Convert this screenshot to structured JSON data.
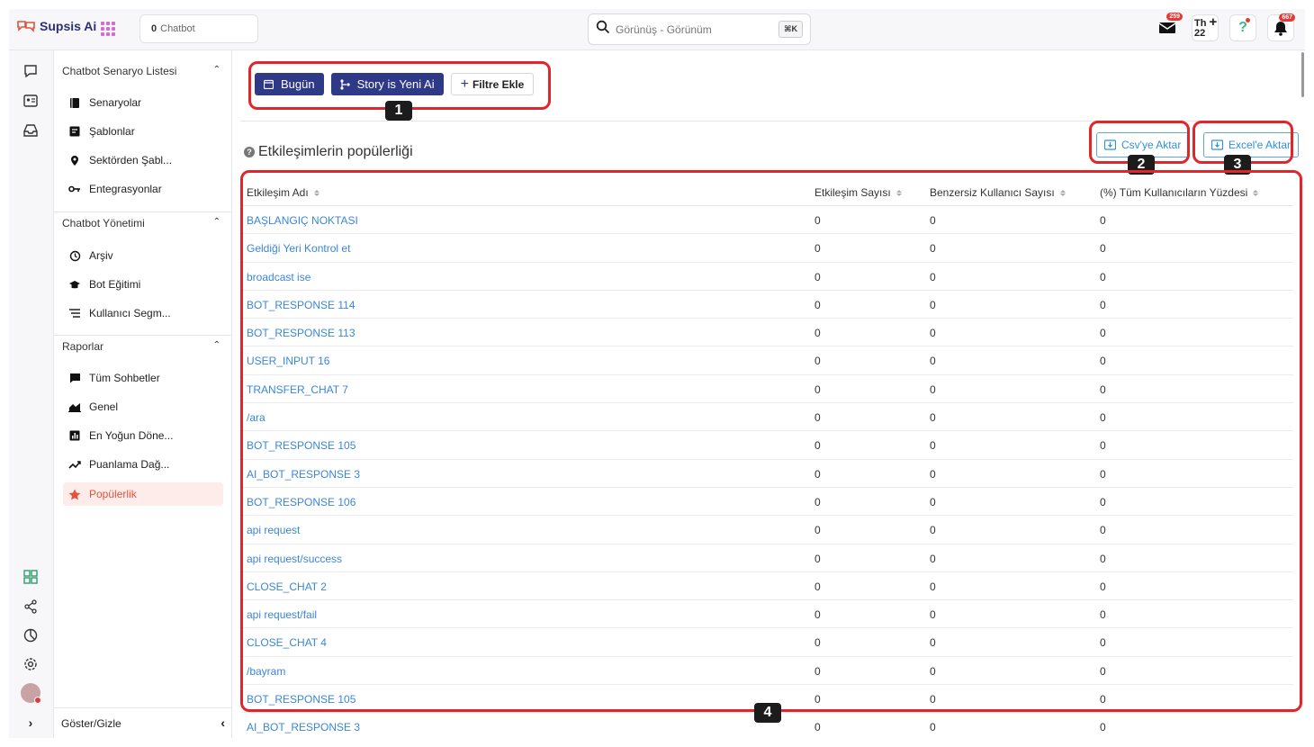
{
  "brand": {
    "name": "Supsis Ai"
  },
  "chatbot_selector": {
    "count": "0",
    "label": "Chatbot"
  },
  "search": {
    "placeholder": "Görünüş - Görünüm",
    "shortcut": "⌘K"
  },
  "topbar": {
    "mail_badge": "259",
    "th_label": "Th",
    "th_num": "22",
    "help": "?",
    "notif_badge": "667"
  },
  "sidebar": {
    "sections": [
      {
        "title": "Chatbot Senaryo Listesi",
        "items": [
          {
            "label": "Senaryolar",
            "icon": "book-icon"
          },
          {
            "label": "Şablonlar",
            "icon": "template-icon"
          },
          {
            "label": "Sektörden Şabl...",
            "icon": "location-icon"
          },
          {
            "label": "Entegrasyonlar",
            "icon": "key-icon"
          }
        ]
      },
      {
        "title": "Chatbot Yönetimi",
        "items": [
          {
            "label": "Arşiv",
            "icon": "history-icon"
          },
          {
            "label": "Bot Eğitimi",
            "icon": "graduation-cap-icon"
          },
          {
            "label": "Kullanıcı Segm...",
            "icon": "list-icon"
          }
        ]
      },
      {
        "title": "Raporlar",
        "items": [
          {
            "label": "Tüm Sohbetler",
            "icon": "chat-icon"
          },
          {
            "label": "Genel",
            "icon": "area-chart-icon"
          },
          {
            "label": "En Yoğun Döne...",
            "icon": "bar-chart-icon"
          },
          {
            "label": "Puanlama Dağ...",
            "icon": "trend-icon"
          },
          {
            "label": "Popülerlik",
            "icon": "star-icon"
          }
        ]
      }
    ],
    "toggle_label": "Göster/Gizle"
  },
  "filters": {
    "today": "Bugün",
    "story": "Story is Yeni Ai",
    "add_filter": "Filtre Ekle"
  },
  "page_title": "Etkileşimlerin popülerliği",
  "export": {
    "csv": "Csv'ye Aktar",
    "excel": "Excel'e Aktar"
  },
  "table": {
    "headers": [
      "Etkileşim Adı",
      "Etkileşim Sayısı",
      "Benzersiz Kullanıcı Sayısı",
      "(%) Tüm Kullanıcıların Yüzdesi"
    ],
    "rows": [
      [
        "BAŞLANGIÇ NOKTASI",
        "0",
        "0",
        "0"
      ],
      [
        "Geldiği Yeri Kontrol et",
        "0",
        "0",
        "0"
      ],
      [
        "broadcast ise",
        "0",
        "0",
        "0"
      ],
      [
        "BOT_RESPONSE 114",
        "0",
        "0",
        "0"
      ],
      [
        "BOT_RESPONSE 113",
        "0",
        "0",
        "0"
      ],
      [
        "USER_INPUT 16",
        "0",
        "0",
        "0"
      ],
      [
        "TRANSFER_CHAT 7",
        "0",
        "0",
        "0"
      ],
      [
        "/ara",
        "0",
        "0",
        "0"
      ],
      [
        "BOT_RESPONSE 105",
        "0",
        "0",
        "0"
      ],
      [
        "AI_BOT_RESPONSE 3",
        "0",
        "0",
        "0"
      ],
      [
        "BOT_RESPONSE 106",
        "0",
        "0",
        "0"
      ],
      [
        "api request",
        "0",
        "0",
        "0"
      ],
      [
        "api request/success",
        "0",
        "0",
        "0"
      ],
      [
        "CLOSE_CHAT 2",
        "0",
        "0",
        "0"
      ],
      [
        "api request/fail",
        "0",
        "0",
        "0"
      ],
      [
        "CLOSE_CHAT 4",
        "0",
        "0",
        "0"
      ],
      [
        "/bayram",
        "0",
        "0",
        "0"
      ],
      [
        "BOT_RESPONSE 105",
        "0",
        "0",
        "0"
      ],
      [
        "AI_BOT_RESPONSE 3",
        "0",
        "0",
        "0"
      ]
    ]
  },
  "annotations": [
    "1",
    "2",
    "3",
    "4"
  ],
  "colors": {
    "accent": "#2e3a87",
    "link": "#3b86d9",
    "annotation": "#e0262a",
    "active": "#e0533d"
  }
}
